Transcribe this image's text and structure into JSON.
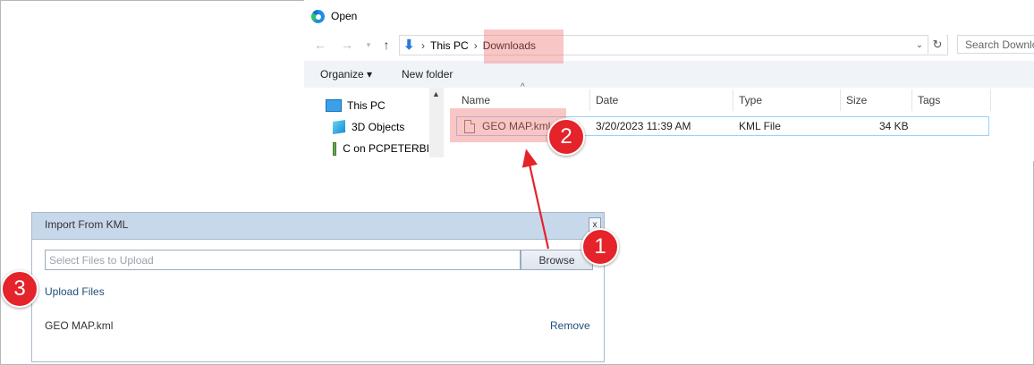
{
  "open_dialog": {
    "title": "Open",
    "address": {
      "root": "This PC",
      "folder": "Downloads"
    },
    "search_placeholder": "Search Downloads",
    "toolbar": {
      "organize": "Organize ▾",
      "new_folder": "New folder"
    },
    "nav_items": [
      "This PC",
      "3D Objects",
      "C on PCPETERBI"
    ],
    "columns": [
      "Name",
      "Date",
      "Type",
      "Size",
      "Tags"
    ],
    "file": {
      "name": "GEO MAP.kml",
      "date": "3/20/2023 11:39 AM",
      "type": "KML File",
      "size": "34 KB"
    }
  },
  "kml_dialog": {
    "title": "Import From KML",
    "close_label": "x",
    "file_input_placeholder": "Select Files to Upload",
    "browse_label": "Browse",
    "upload_label": "Upload Files",
    "selected_file": "GEO MAP.kml",
    "remove_label": "Remove"
  },
  "annotations": {
    "badge_1": "1",
    "badge_2": "2",
    "badge_3": "3"
  },
  "colors": {
    "highlight": "#f07878",
    "badge": "#e4232a",
    "arrow": "#e4232a",
    "dialog_header": "#c8d8eb"
  },
  "icons": [
    "edge-icon",
    "back-arrow-icon",
    "forward-arrow-icon",
    "up-arrow-icon",
    "downloads-icon",
    "refresh-icon",
    "this-pc-icon",
    "3d-objects-icon",
    "network-drive-icon",
    "document-icon",
    "close-icon"
  ]
}
